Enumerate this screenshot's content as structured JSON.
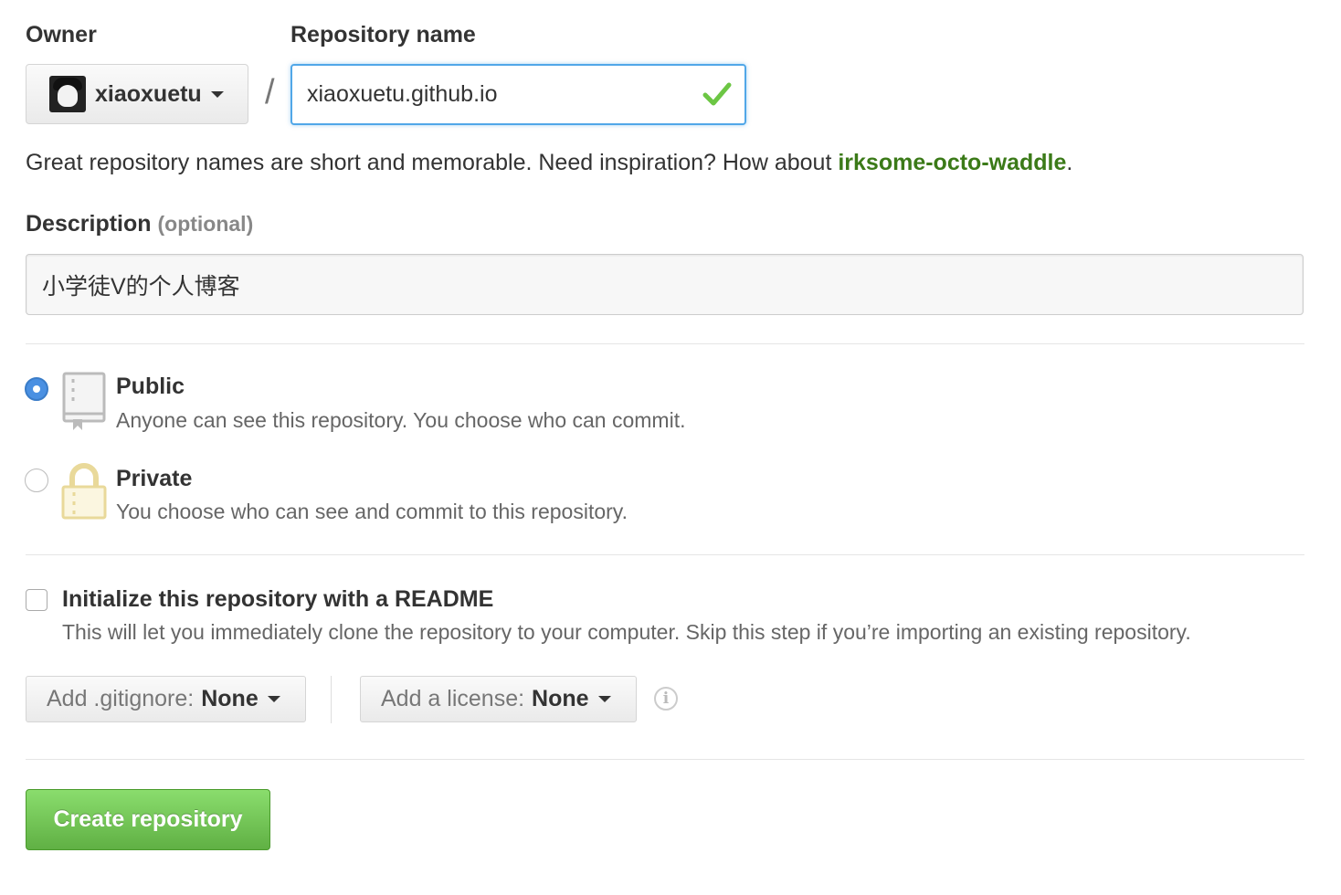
{
  "owner": {
    "label": "Owner",
    "selected": "xiaoxuetu"
  },
  "repo_name": {
    "label": "Repository name",
    "value": "xiaoxuetu.github.io",
    "separator": "/"
  },
  "hint": {
    "text": "Great repository names are short and memorable. Need inspiration? How about ",
    "suggestion": "irksome-octo-waddle",
    "end": "."
  },
  "description": {
    "label": "Description",
    "optional": "(optional)",
    "value": "小学徒V的个人博客"
  },
  "visibility": {
    "public": {
      "title": "Public",
      "desc": "Anyone can see this repository. You choose who can commit.",
      "selected": true
    },
    "private": {
      "title": "Private",
      "desc": "You choose who can see and commit to this repository.",
      "selected": false
    }
  },
  "readme": {
    "title": "Initialize this repository with a README",
    "desc": "This will let you immediately clone the repository to your computer. Skip this step if you’re importing an existing repository.",
    "checked": false
  },
  "gitignore": {
    "prefix": "Add .gitignore:",
    "value": "None"
  },
  "license": {
    "prefix": "Add a license:",
    "value": "None"
  },
  "info_glyph": "i",
  "create_button": "Create repository",
  "colors": {
    "focus_border": "#51a7e8",
    "check_green": "#6cc644",
    "suggestion_green": "#3b7a18",
    "radio_blue": "#4a90e2",
    "create_green": "#60b044",
    "private_lock": "#e9d99a"
  }
}
